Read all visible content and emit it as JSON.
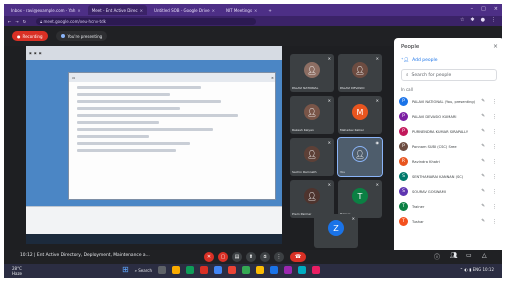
{
  "browser": {
    "tabs": [
      {
        "label": "Inbox - ravi@example.com - Yah",
        "active": false
      },
      {
        "label": "Meet - Ent Active Direc",
        "active": true
      },
      {
        "label": "Untitled SOB - Google Drive",
        "active": false
      },
      {
        "label": "NIT Meetings",
        "active": false
      }
    ],
    "url": "meet.google.com/xeu-hcnv-tdk"
  },
  "meet": {
    "recording_label": "Recording",
    "presenting_label": "You're presenting"
  },
  "tiles": [
    {
      "name": "PALAVI NATIONAL",
      "avatar": "photo",
      "color": "#8d6e63"
    },
    {
      "name": "PALAVI DEVASIO",
      "avatar": "photo",
      "color": "#6d4c41"
    },
    {
      "name": "Rakesh Kalyan",
      "avatar": "photo",
      "color": "#795548"
    },
    {
      "name": "Mahadev Kalkar",
      "avatar": "M",
      "color": "#e8551f"
    },
    {
      "name": "Sachin Ramnath",
      "avatar": "photo",
      "color": "#5d4037"
    },
    {
      "name": "You",
      "avatar": "photo",
      "color": "#4e5d6c"
    },
    {
      "name": "Prem Parmar",
      "avatar": "photo",
      "color": "#4e342e"
    },
    {
      "name": "Trainer",
      "avatar": "T",
      "color": "#0b8043"
    },
    {
      "name": "",
      "avatar": "Z",
      "color": "#1a73e8"
    }
  ],
  "people_panel": {
    "title": "People",
    "add_people": "Add people",
    "search_placeholder": "Search for people",
    "section_label": "In call",
    "participants": [
      {
        "name": "PALAVI NATIONAL (You, presenting)",
        "initial": "P",
        "color": "#1a73e8"
      },
      {
        "name": "PALAVI DEVASIO KUMARI",
        "initial": "P",
        "color": "#7b1fa2"
      },
      {
        "name": "PURNENDRA KUMAR SIRAPALLY",
        "initial": "P",
        "color": "#c2185b"
      },
      {
        "name": "Ponnam SUBI (CSC) Sree",
        "initial": "P",
        "color": "#6d4c41"
      },
      {
        "name": "Ravindra Khatri",
        "initial": "R",
        "color": "#e8551f"
      },
      {
        "name": "SENTHAMARAI KANNAN (SC)",
        "initial": "S",
        "color": "#00796b"
      },
      {
        "name": "SOURAV GOSWAMI",
        "initial": "S",
        "color": "#5e35b1"
      },
      {
        "name": "Trainer",
        "initial": "T",
        "color": "#0b8043"
      },
      {
        "name": "Tushar",
        "initial": "T",
        "color": "#f4511e"
      }
    ]
  },
  "controls": {
    "meeting_info": "10:12 | Ent Active Directory, Deployment, Maintenance a..."
  },
  "taskbar": {
    "weather_temp": "28°C",
    "weather_desc": "Haze",
    "search_label": "Search",
    "tray_text": "ENG 10:12"
  }
}
